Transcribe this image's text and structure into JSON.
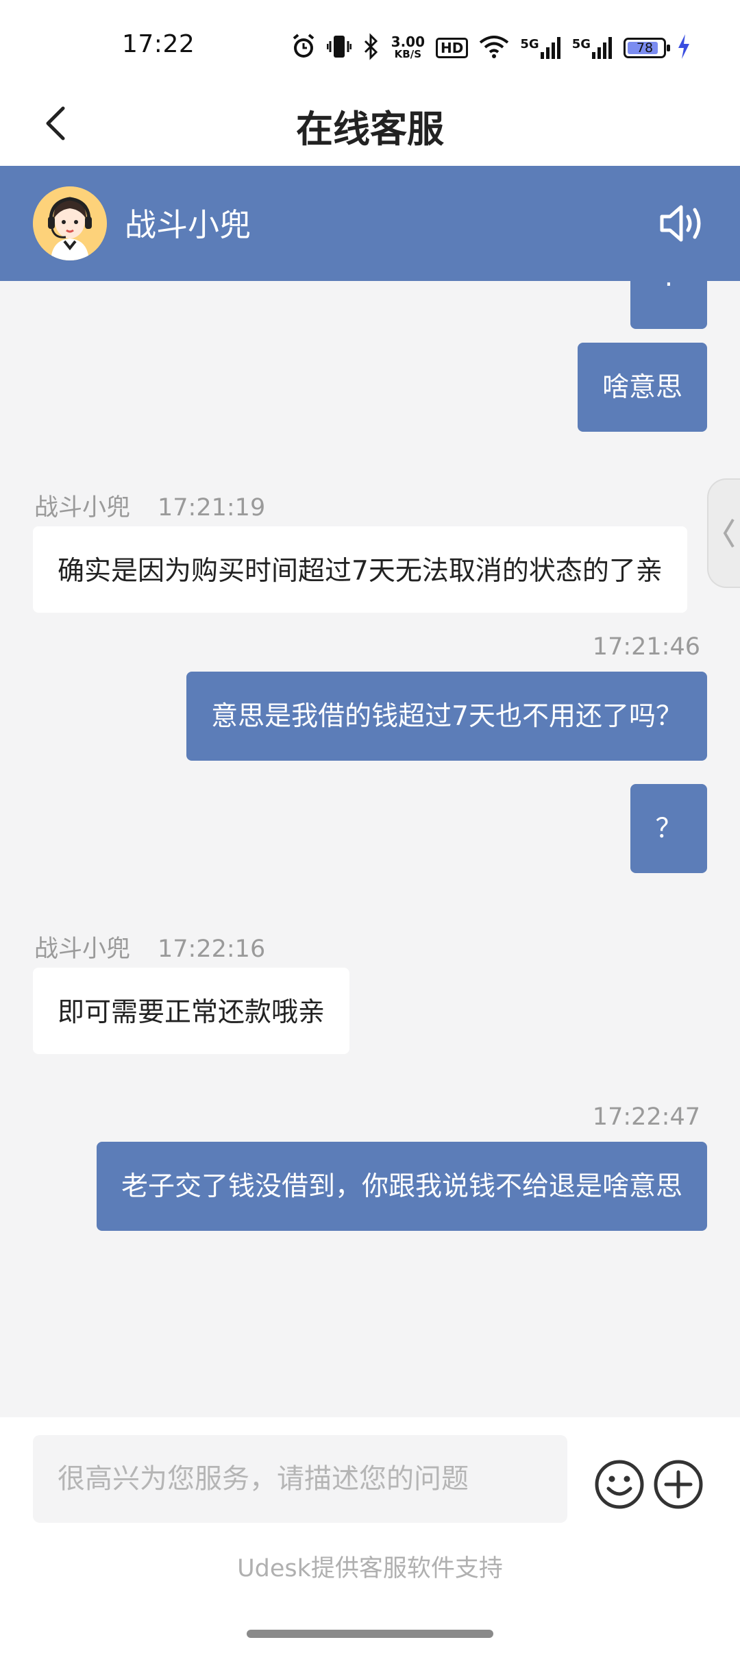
{
  "status_bar": {
    "time": "17:22",
    "network_speed_value": "3.00",
    "network_speed_unit": "KB/S",
    "hd_badge": "HD",
    "signal_1": "5G",
    "signal_2": "5G",
    "battery": "78",
    "icons": [
      "alarm-icon",
      "vibrate-icon",
      "bluetooth-icon",
      "hd-icon",
      "wifi-icon",
      "signal-icon",
      "signal-icon",
      "battery-icon",
      "charging-icon"
    ]
  },
  "nav": {
    "title": "在线客服",
    "back_icon": "chevron-left-icon"
  },
  "agent": {
    "name": "战斗小兜",
    "avatar_icon": "agent-avatar-icon",
    "speaker_icon": "speaker-icon"
  },
  "messages": [
    {
      "side": "out",
      "text": "."
    },
    {
      "side": "out",
      "text": "啥意思"
    },
    {
      "side": "in",
      "sender": "战斗小兜",
      "time": "17:21:19",
      "text": "确实是因为购买时间超过7天无法取消的状态的了亲"
    },
    {
      "side": "out",
      "time": "17:21:46",
      "text": "意思是我借的钱超过7天也不用还了吗？"
    },
    {
      "side": "out",
      "text": "？"
    },
    {
      "side": "in",
      "sender": "战斗小兜",
      "time": "17:22:16",
      "text": "即可需要正常还款哦亲"
    },
    {
      "side": "out",
      "time": "17:22:47",
      "text": "老子交了钱没借到，你跟我说钱不给退是啥意思"
    }
  ],
  "input": {
    "placeholder": "很高兴为您服务，请描述您的问题",
    "value": ""
  },
  "footer": {
    "powered_by": "Udesk提供客服软件支持"
  },
  "colors": {
    "accent": "#5c7db8",
    "background": "#f4f4f5",
    "meta_text": "#9a9a9a"
  }
}
